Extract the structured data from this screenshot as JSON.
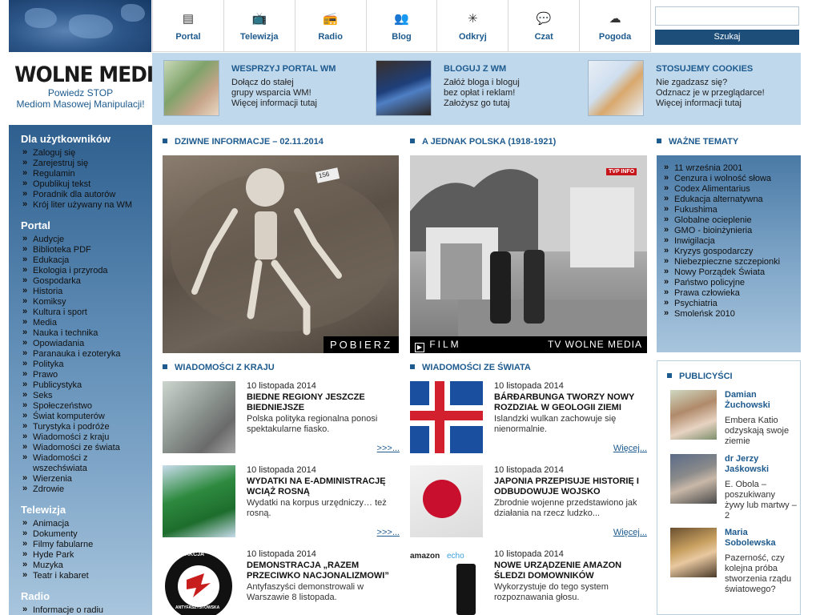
{
  "nav": {
    "items": [
      {
        "label": "Portal",
        "icon": "newspaper-icon",
        "glyph": "▤"
      },
      {
        "label": "Telewizja",
        "icon": "tv-icon",
        "glyph": "📺"
      },
      {
        "label": "Radio",
        "icon": "radio-icon",
        "glyph": "📻"
      },
      {
        "label": "Blog",
        "icon": "people-icon",
        "glyph": "👥"
      },
      {
        "label": "Odkryj",
        "icon": "cursor-click-icon",
        "glyph": "✳"
      },
      {
        "label": "Czat",
        "icon": "speech-bubble-icon",
        "glyph": "💬"
      },
      {
        "label": "Pogoda",
        "icon": "weather-icon",
        "glyph": "☁"
      }
    ]
  },
  "search": {
    "button": "Szukaj",
    "value": ""
  },
  "logo": {
    "brand": "WOLNE MEDIA",
    "tag1": "Powiedz STOP",
    "tag2": "Mediom Masowej Manipulacji!"
  },
  "promo": [
    {
      "title": "WESPRZYJ PORTAL WM",
      "lines": [
        "Dołącz do stałej",
        "grupy wsparcia WM!",
        "Więcej informacji tutaj"
      ]
    },
    {
      "title": "BLOGUJ Z WM",
      "lines": [
        "Załóż bloga i bloguj",
        "bez opłat i reklam!",
        "Założysz go tutaj"
      ]
    },
    {
      "title": "STOSUJEMY COOKIES",
      "lines": [
        "Nie zgadzasz się?",
        "Odznacz je w przeglądarce!",
        "Więcej informacji tutaj"
      ]
    }
  ],
  "sidebar": {
    "users_title": "Dla użytkowników",
    "users": [
      "Zaloguj się",
      "Zarejestruj się",
      "Regulamin",
      "Opublikuj tekst",
      "Poradnik dla autorów",
      "Krój liter używany na WM"
    ],
    "portal_title": "Portal",
    "portal": [
      "Audycje",
      "Biblioteka PDF",
      "Edukacja",
      "Ekologia i przyroda",
      "Gospodarka",
      "Historia",
      "Komiksy",
      "Kultura i sport",
      "Media",
      "Nauka i technika",
      "Opowiadania",
      "Paranauka i ezoteryka",
      "Polityka",
      "Prawo",
      "Publicystyka",
      "Seks",
      "Społeczeństwo",
      "Świat komputerów",
      "Turystyka i podróże",
      "Wiadomości z kraju",
      "Wiadomości ze świata",
      "Wiadomości z wszechświata",
      "Wierzenia",
      "Zdrowie"
    ],
    "tv_title": "Telewizja",
    "tv": [
      "Animacja",
      "Dokumenty",
      "Filmy fabularne",
      "Hyde Park",
      "Muzyka",
      "Teatr i kabaret"
    ],
    "radio_title": "Radio",
    "radio": [
      "Informacje o radiu"
    ]
  },
  "heads": {
    "feat1": "DZIWNE INFORMACJE – 02.11.2014",
    "feat2": "A JEDNAK POLSKA (1918-1921)",
    "topics": "WAŻNE TEMATY",
    "kraj": "WIADOMOŚCI Z KRAJU",
    "swiat": "WIADOMOŚCI ZE ŚWIATA",
    "pub": "PUBLICYŚCI"
  },
  "feat1": {
    "overlay": "POBIERZ",
    "tag": "156"
  },
  "feat2": {
    "overlay_left": "FILM",
    "overlay_right": "TV WOLNE MEDIA",
    "logo": "TVP INFO"
  },
  "topics": [
    "11 września 2001",
    "Cenzura i wolność słowa",
    "Codex Alimentarius",
    "Edukacja alternatywna",
    "Fukushima",
    "Globalne ocieplenie",
    "GMO - bioinżynieria",
    "Inwigilacja",
    "Kryzys gospodarczy",
    "Niebezpieczne szczepionki",
    "Nowy Porządek Świata",
    "Państwo policyjne",
    "Prawa człowieka",
    "Psychiatria",
    "Smoleńsk 2010"
  ],
  "kraj": [
    {
      "date": "10 listopada 2014",
      "title": "Biedne regiony jeszcze biedniejsze",
      "desc": "Polska polityka regionalna ponosi spektakularne fiasko.",
      "more": ">>>..."
    },
    {
      "date": "10 listopada 2014",
      "title": "Wydatki na e-administrację wciąż rosną",
      "desc": "Wydatki na korpus urzędniczy… też rosną.",
      "more": ">>>..."
    },
    {
      "date": "10 listopada 2014",
      "title": "Demonstracja „Razem przeciwko nacjonalizmowi”",
      "desc": "Antyfaszyści demonstrowali w Warszawie 8 listopada.",
      "more": ">>>...",
      "img_top": "AKCJA",
      "img_bottom": "ANTYFASZYSTOWSKA"
    }
  ],
  "swiat": [
    {
      "date": "10 listopada 2014",
      "title": "Bárðarbunga tworzy nowy rozdział w geologii Ziemi",
      "desc": "Islandzki wulkan zachowuje się nienormalnie.",
      "more": "Więcej..."
    },
    {
      "date": "10 listopada 2014",
      "title": "Japonia przepisuje historię i odbudowuje wojsko",
      "desc": "Zbrodnie wojenne przedstawiono jak działania na rzecz ludzko...",
      "more": "Więcej..."
    },
    {
      "date": "10 listopada 2014",
      "title": "Nowe urządzenie Amazon śledzi domowników",
      "desc": "Wykorzystuje do tego system rozpoznawania głosu.",
      "more": "Więcej...",
      "img_label_a": "amazon",
      "img_label_b": "echo"
    }
  ],
  "publicists": [
    {
      "name": "Damian Żuchowski",
      "text": "Embera Katio odzyskają swoje ziemie"
    },
    {
      "name": "dr Jerzy Jaśkowski",
      "text": "E. Obola – poszukiwany żywy lub martwy – 2"
    },
    {
      "name": "Maria Sobolewska",
      "text": "Pazerność, czy kolejna próba stworzenia rządu światowego?"
    }
  ]
}
